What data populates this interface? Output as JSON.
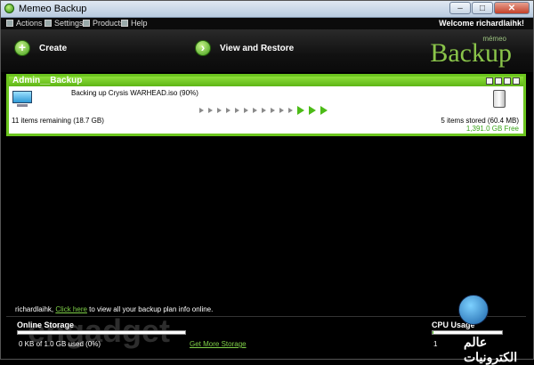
{
  "window": {
    "title": "Memeo Backup",
    "min": "–",
    "max": "□",
    "close": "✕"
  },
  "menu": {
    "actions": "Actions",
    "settings": "Settings",
    "products": "Products",
    "help": "Help"
  },
  "welcome": "Welcome richardlaihk!",
  "toolbar": {
    "create": "Create",
    "view_restore": "View and Restore"
  },
  "brand": {
    "small": "mémeo",
    "big": "Backup"
  },
  "plan": {
    "name": "Admin__Backup",
    "status": "Backing up Crysis WARHEAD.iso (90%)",
    "remaining": "11 items remaining (18.7 GB)",
    "stored": "5 items stored (60.4 MB)",
    "free": "1,391.0 GB Free"
  },
  "footer": {
    "user": "richardlaihk, ",
    "link": "Click here",
    "rest": " to view all your backup plan info online.",
    "storage_label": "Online Storage",
    "storage_used": "0 KB of 1.0 GB used (0%)",
    "storage_fraction": 0.0,
    "more_storage": "Get More Storage",
    "cpu_label": "CPU Usage",
    "cpu_value": "1",
    "cpu_fraction": 0.01
  },
  "watermark": {
    "left": "engadget",
    "right": "عالم الكترونيات"
  },
  "colors": {
    "accent": "#6cc51e",
    "link": "#7fd048",
    "background": "#000000"
  }
}
